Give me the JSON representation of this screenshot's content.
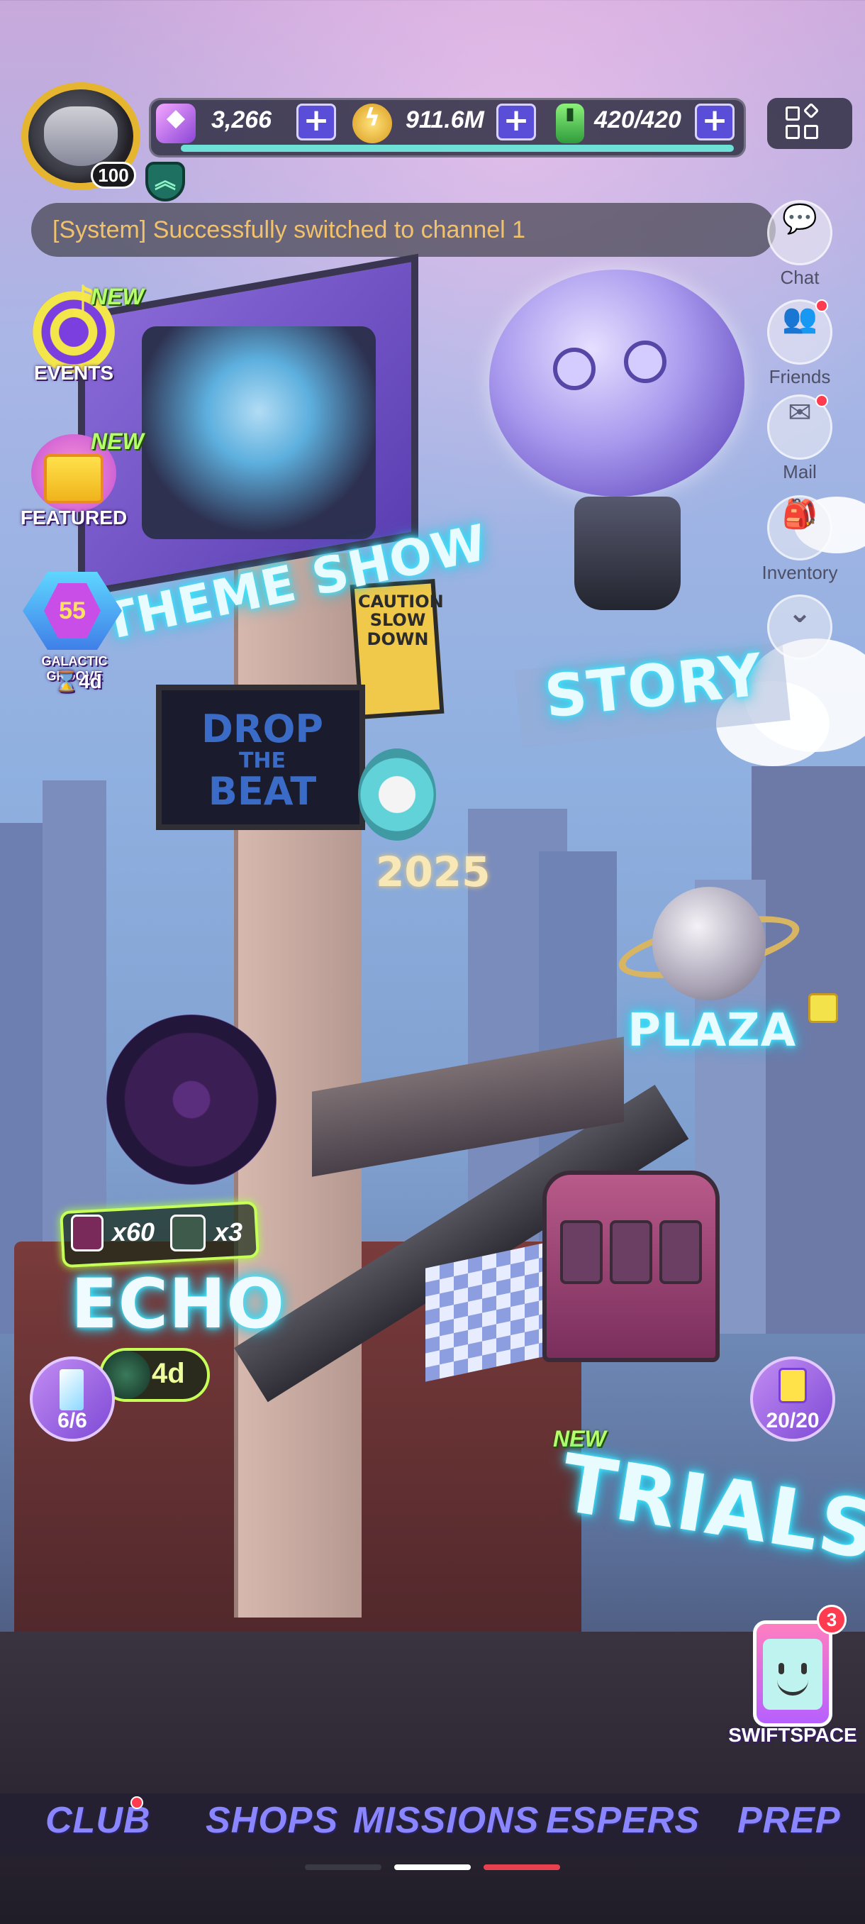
{
  "player": {
    "level": "100",
    "rank_icon": "double-chevron-up-icon"
  },
  "resources": [
    {
      "name": "crystal",
      "icon": "purple-crystal-icon",
      "value": "3,266"
    },
    {
      "name": "coins",
      "icon": "gold-coin-icon",
      "value": "911.6M"
    },
    {
      "name": "stamina",
      "icon": "green-battery-icon",
      "value": "420/420"
    }
  ],
  "system_message": "[System] Successfully switched to channel 1",
  "side_menu": {
    "chat": "Chat",
    "friends": "Friends",
    "mail": "Mail",
    "inventory": "Inventory"
  },
  "left_buttons": {
    "events": {
      "label": "EVENTS",
      "tag": "NEW"
    },
    "featured": {
      "label": "FEATURED",
      "tag": "NEW"
    },
    "galactic_groove": {
      "level": "55",
      "label": "GALACTIC GROOVE",
      "timer": "4d"
    }
  },
  "locations": {
    "theme_show": "THEME SHOW",
    "story": "STORY",
    "plaza": "PLAZA",
    "echo": "ECHO",
    "trials": "TRIALS",
    "trials_tag": "NEW"
  },
  "scene_text": {
    "drop_the_beat": [
      "DROP",
      "THE",
      "BEAT"
    ],
    "caution": [
      "CAUTION",
      "SLOW",
      "DOWN"
    ],
    "year": "2025"
  },
  "echo_rewards": {
    "first": "x60",
    "second": "x3",
    "timer": "4d"
  },
  "counters": {
    "left": "6/6",
    "right": "20/20"
  },
  "swiftspace": {
    "label": "SWIFTSPACE",
    "badge": "3"
  },
  "bottom_nav": [
    "CLUB",
    "SHOPS",
    "MISSIONS",
    "ESPERS",
    "PREP"
  ],
  "colors": {
    "accent": "#8a86ff",
    "neon": "#3fe7ff",
    "new_tag": "#b5ff6a",
    "alert": "#ff3b4f",
    "system_text": "#f2c26a"
  }
}
